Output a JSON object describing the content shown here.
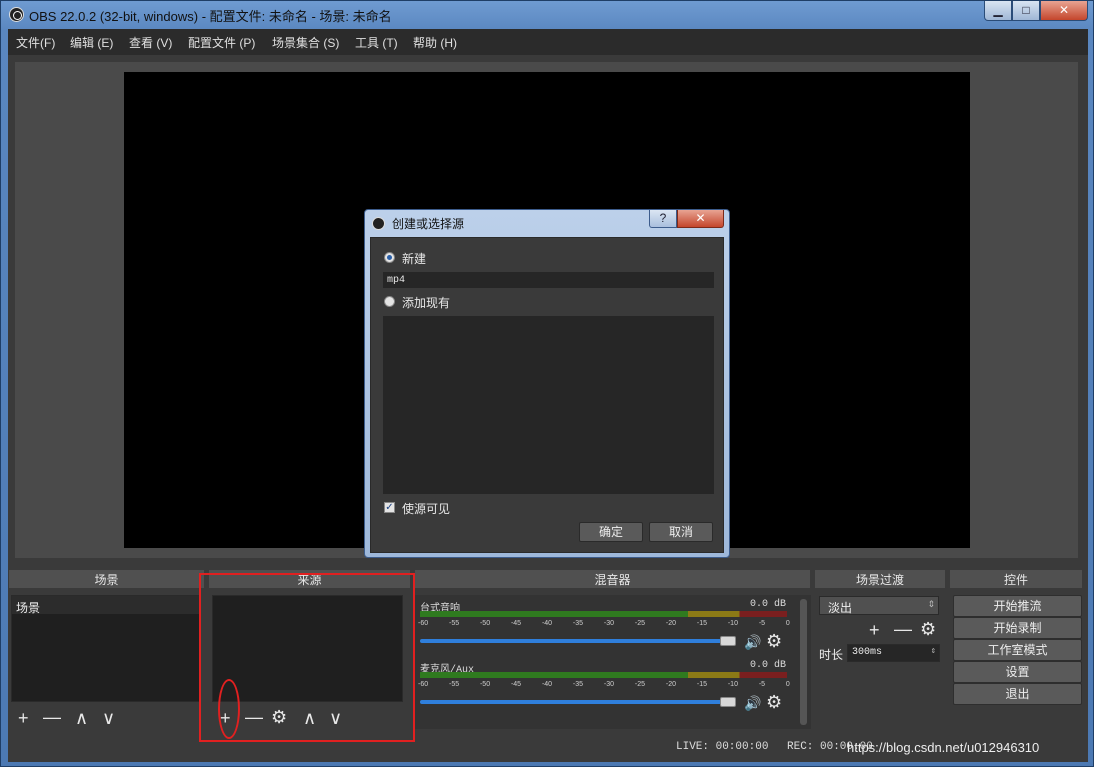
{
  "window": {
    "title": "OBS 22.0.2 (32-bit, windows) - 配置文件: 未命名 - 场景: 未命名",
    "min": "▁",
    "max": "□",
    "close": "✕"
  },
  "menu": [
    "文件(F)",
    "编辑 (E)",
    "查看 (V)",
    "配置文件 (P)",
    "场景集合 (S)",
    "工具 (T)",
    "帮助 (H)"
  ],
  "docks": {
    "scenes": {
      "title": "场景",
      "items": [
        "场景"
      ]
    },
    "sources": {
      "title": "来源"
    },
    "mixer": {
      "title": "混音器",
      "tracks": [
        {
          "name": "台式音响",
          "db": "0.0 dB",
          "level": 1.0
        },
        {
          "name": "麦克风/Aux",
          "db": "0.0 dB",
          "level": 1.0
        }
      ],
      "ticks": [
        "-60",
        "-55",
        "-50",
        "-45",
        "-40",
        "-35",
        "-30",
        "-25",
        "-20",
        "-15",
        "-10",
        "-5",
        "0"
      ]
    },
    "transitions": {
      "title": "场景过渡",
      "selected": "淡出",
      "duration_label": "时长",
      "duration_value": "300ms"
    },
    "controls": {
      "title": "控件",
      "buttons": [
        "开始推流",
        "开始录制",
        "工作室模式",
        "设置",
        "退出"
      ]
    }
  },
  "toolbar": {
    "add": "+",
    "remove": "—",
    "up": "∧",
    "down": "∨",
    "gear": "⚙",
    "speaker": "🔊"
  },
  "status": {
    "live": "LIVE: 00:00:00",
    "rec": "REC: 00:00:00"
  },
  "watermark": "https://blog.csdn.net/u012946310",
  "dialog": {
    "title": "创建或选择源",
    "help": "?",
    "close": "✕",
    "option_new": "新建",
    "name_value": "mp4",
    "option_existing": "添加现有",
    "visible_label": "使源可见",
    "visible_checked": true,
    "ok": "确定",
    "cancel": "取消"
  }
}
